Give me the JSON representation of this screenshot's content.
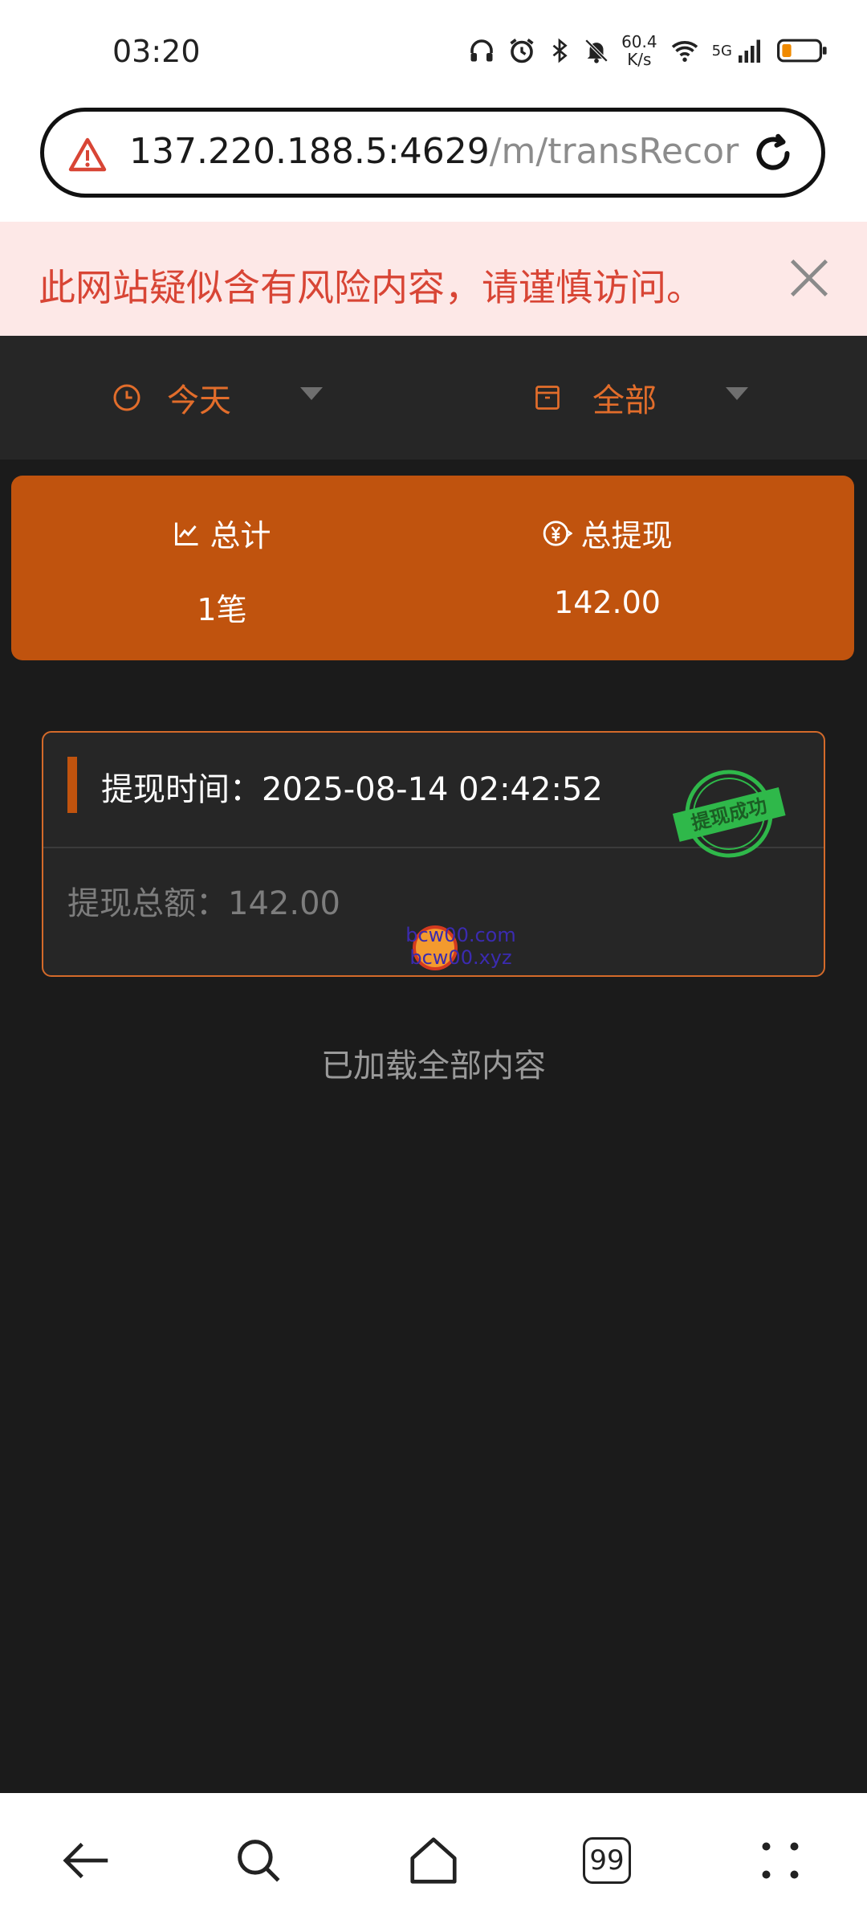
{
  "status_bar": {
    "time": "03:20",
    "net_speed": "60.4",
    "net_speed_unit": "K/s",
    "network_type": "5G",
    "icons": [
      "headphones-icon",
      "alarm-icon",
      "bluetooth-icon",
      "bell-off-icon",
      "wifi-icon",
      "signal-icon",
      "battery-icon"
    ]
  },
  "address_bar": {
    "host": "137.220.188.5:4629",
    "path": "/m/transRecor"
  },
  "risk_banner": {
    "text": "此网站疑似含有风险内容，请谨慎访问。"
  },
  "filters": {
    "date_label": "今天",
    "type_label": "全部"
  },
  "summary": {
    "count_label": "总计",
    "count_value": "1笔",
    "withdraw_label": "总提现",
    "withdraw_value": "142.00"
  },
  "record": {
    "time_label": "提现时间：",
    "time_value": "2025-08-14 02:42:52",
    "amount_label": "提现总额：",
    "amount_value": "142.00",
    "stamp_text": "提现成功",
    "watermark_line1": "bcw00.com",
    "watermark_line2": "bcw00.xyz"
  },
  "list_footer": "已加载全部内容",
  "bottom_nav": {
    "tabs_count": "99"
  },
  "colors": {
    "accent": "#c0530e",
    "accent_text": "#e26d2b",
    "risk_text": "#d84535",
    "stamp_green": "#2fb84a"
  }
}
